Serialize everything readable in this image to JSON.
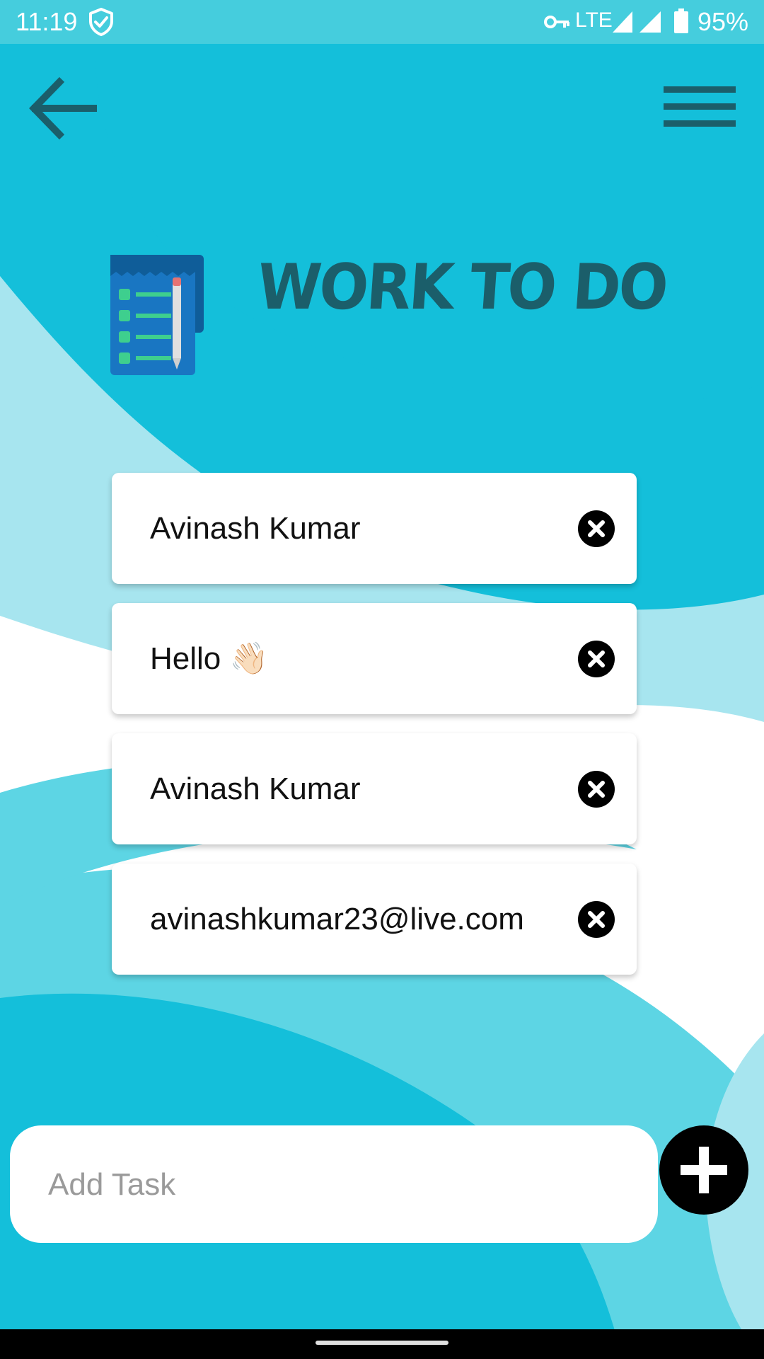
{
  "status_bar": {
    "time": "11:19",
    "network": "LTE",
    "battery_percent": "95%",
    "icons": [
      "shield-check-icon",
      "vpn-key-icon",
      "signal-icon",
      "signal-icon",
      "battery-icon"
    ]
  },
  "header": {
    "back_icon": "arrow-left-icon",
    "menu_icon": "hamburger-menu-icon",
    "title": "WORK TO DO",
    "logo_icon": "notepad-checklist-icon"
  },
  "tasks": [
    {
      "text": "Avinash Kumar",
      "delete_icon": "close-circle-icon"
    },
    {
      "text": "Hello 👋🏻",
      "delete_icon": "close-circle-icon"
    },
    {
      "text": "Avinash Kumar",
      "delete_icon": "close-circle-icon"
    },
    {
      "text": "avinashkumar23@live.com",
      "delete_icon": "close-circle-icon"
    }
  ],
  "add_task": {
    "value": "",
    "placeholder": "Add Task",
    "button_icon": "plus-icon"
  },
  "colors": {
    "background": "#14bfda",
    "status_bar": "#45cddd",
    "title": "#1b5e6a",
    "icon_dark": "#1b5e6a",
    "card": "#ffffff",
    "button": "#000000"
  }
}
